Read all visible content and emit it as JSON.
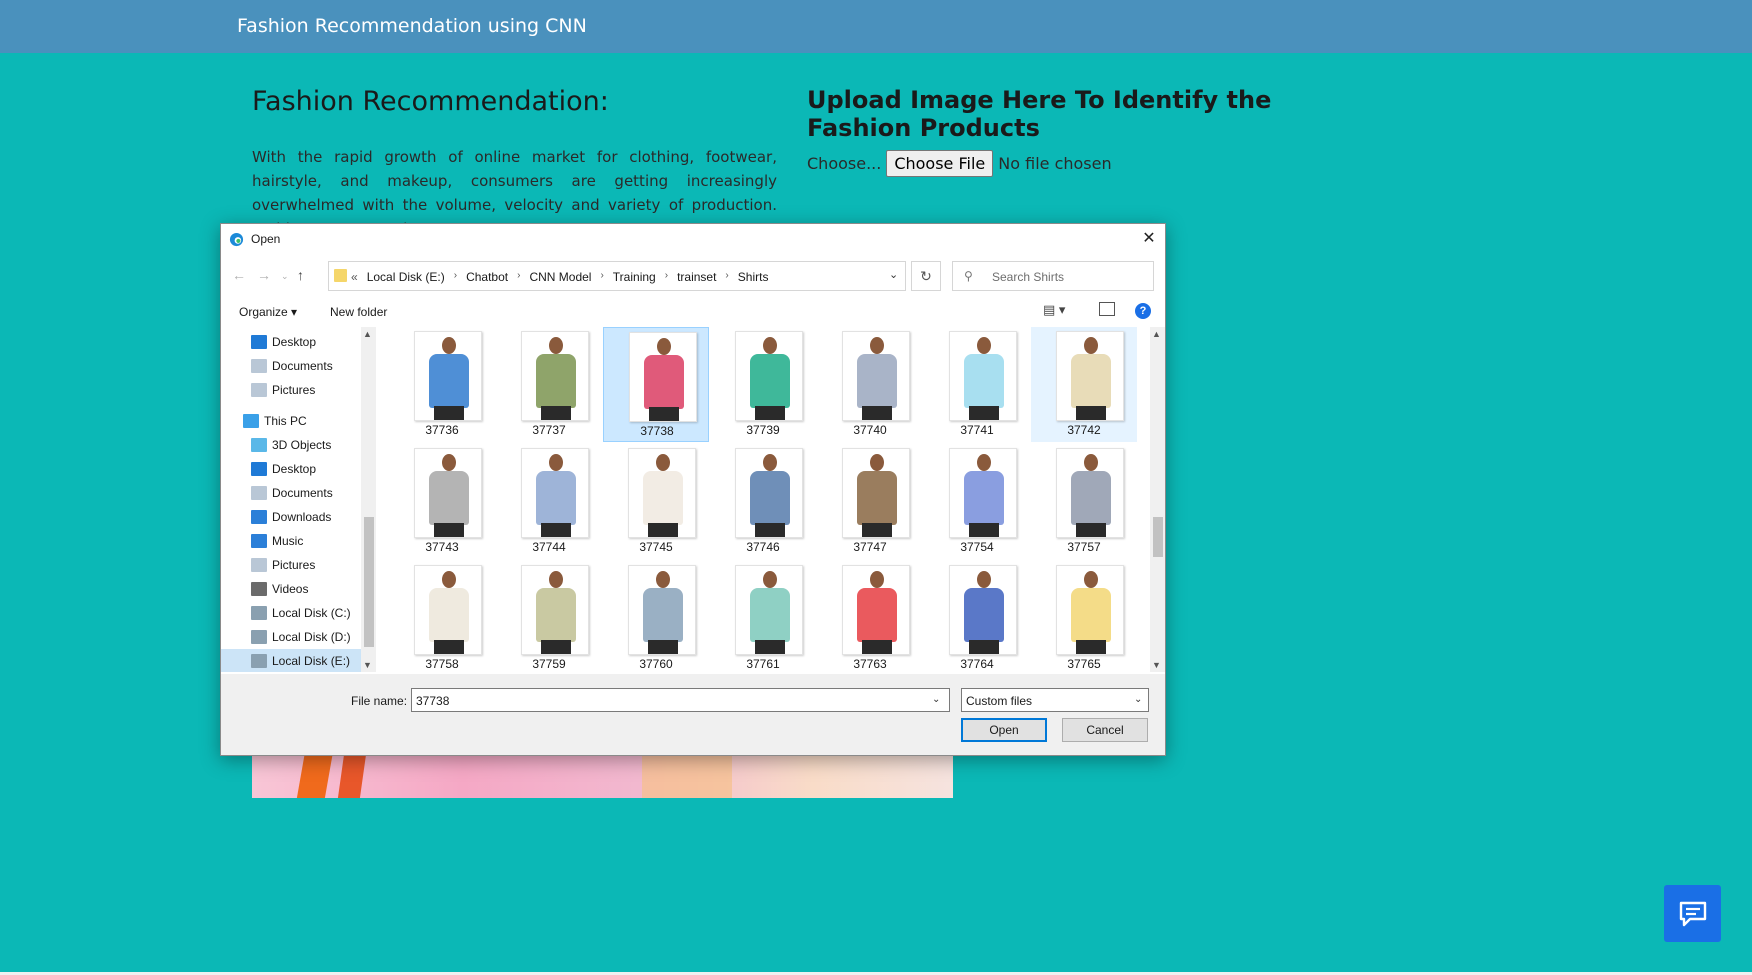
{
  "header": {
    "brand": "Fashion Recommendation using CNN"
  },
  "left": {
    "title": "Fashion Recommendation:",
    "paragraph": "With the rapid growth of online market for clothing, footwear, hairstyle, and makeup, consumers are getting increasingly overwhelmed with the volume, velocity and variety of production. Fashion Recommender"
  },
  "right": {
    "title": "Upload Image Here To Identify the Fashion Products",
    "choose_label": "Choose...",
    "choose_button": "Choose File",
    "no_file": "No file chosen"
  },
  "dialog": {
    "title": "Open",
    "close": "✕",
    "address": {
      "overflow": "«",
      "crumbs": [
        "Local Disk (E:)",
        "Chatbot",
        "CNN Model",
        "Training",
        "trainset",
        "Shirts"
      ]
    },
    "search_placeholder": "Search Shirts",
    "toolbar": {
      "organize": "Organize ▾",
      "new_folder": "New folder",
      "help": "?"
    },
    "nav_items": [
      {
        "label": "Desktop",
        "icon": "desktop-icon",
        "color": "#1f7ad6"
      },
      {
        "label": "Documents",
        "icon": "documents-icon",
        "color": "#b9c7d6"
      },
      {
        "label": "Pictures",
        "icon": "pictures-icon",
        "color": "#b9c7d6"
      },
      {
        "label": "This PC",
        "icon": "pc-icon",
        "color": "#3aa0e8"
      },
      {
        "label": "3D Objects",
        "icon": "cube-icon",
        "color": "#5ab8e8"
      },
      {
        "label": "Desktop",
        "icon": "desktop-icon",
        "color": "#1f7ad6"
      },
      {
        "label": "Documents",
        "icon": "documents-icon",
        "color": "#b9c7d6"
      },
      {
        "label": "Downloads",
        "icon": "download-icon",
        "color": "#2b7fd8"
      },
      {
        "label": "Music",
        "icon": "music-icon",
        "color": "#2b7fd8"
      },
      {
        "label": "Pictures",
        "icon": "pictures-icon",
        "color": "#b9c7d6"
      },
      {
        "label": "Videos",
        "icon": "videos-icon",
        "color": "#6b6b6b"
      },
      {
        "label": "Local Disk (C:)",
        "icon": "drive-icon",
        "color": "#8aa0b0"
      },
      {
        "label": "Local Disk (D:)",
        "icon": "drive-icon",
        "color": "#8aa0b0"
      },
      {
        "label": "Local Disk (E:)",
        "icon": "drive-icon",
        "color": "#8aa0b0"
      }
    ],
    "files": [
      {
        "name": "37736",
        "color": "#4f8fd6"
      },
      {
        "name": "37737",
        "color": "#8fa46a"
      },
      {
        "name": "37738",
        "color": "#e05a7a"
      },
      {
        "name": "37739",
        "color": "#3fb89a"
      },
      {
        "name": "37740",
        "color": "#a9b4c8"
      },
      {
        "name": "37741",
        "color": "#a8dff0"
      },
      {
        "name": "37742",
        "color": "#e8dcb8"
      },
      {
        "name": "37743",
        "color": "#b4b4b4"
      },
      {
        "name": "37744",
        "color": "#9eb4d8"
      },
      {
        "name": "37745",
        "color": "#f2ece4"
      },
      {
        "name": "37746",
        "color": "#6f8fb8"
      },
      {
        "name": "37747",
        "color": "#9a7d5e"
      },
      {
        "name": "37754",
        "color": "#8a9ee0"
      },
      {
        "name": "37757",
        "color": "#a0a8b8"
      },
      {
        "name": "37758",
        "color": "#efeadf"
      },
      {
        "name": "37759",
        "color": "#c9c9a2"
      },
      {
        "name": "37760",
        "color": "#9ab0c4"
      },
      {
        "name": "37761",
        "color": "#8fd0c4"
      },
      {
        "name": "37763",
        "color": "#ea5a5e"
      },
      {
        "name": "37764",
        "color": "#5a78c8"
      },
      {
        "name": "37765",
        "color": "#f4dc88"
      }
    ],
    "selected_file": "37738",
    "footer": {
      "filename_label": "File name:",
      "filename_value": "37738",
      "filetype": "Custom files",
      "open": "Open",
      "cancel": "Cancel"
    }
  }
}
